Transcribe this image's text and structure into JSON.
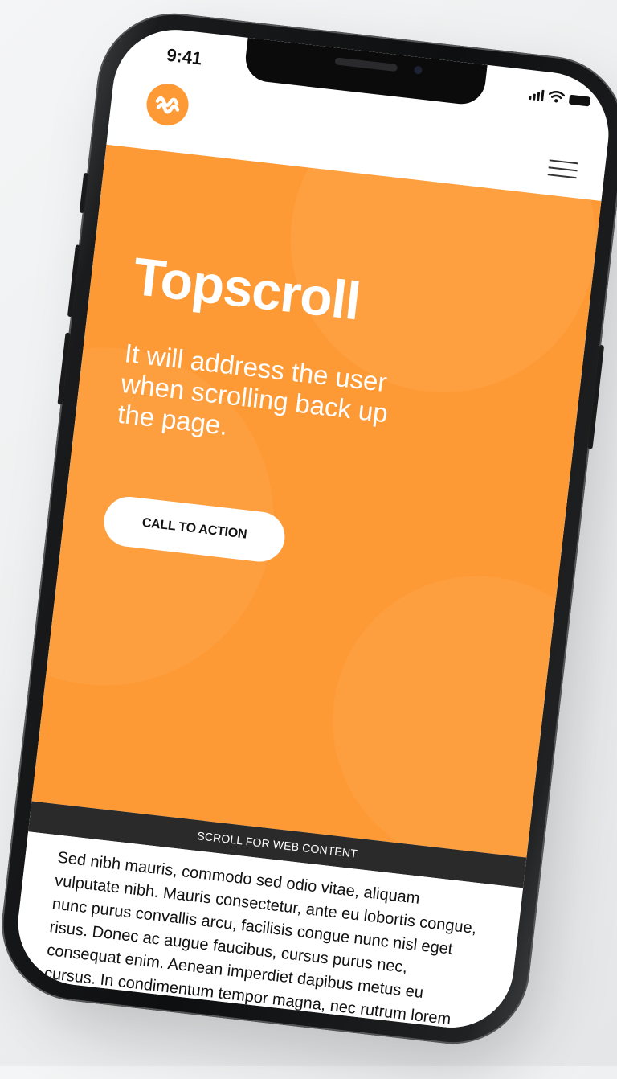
{
  "status_bar": {
    "time": "9:41"
  },
  "header": {
    "logo_icon": "logo-icon",
    "menu_icon": "hamburger-menu-icon"
  },
  "hero": {
    "title": "Topscroll",
    "subtitle": "It will address the user when scrolling back up the page.",
    "cta_label": "CALL TO ACTION",
    "background_color": "#fe9a35"
  },
  "scroll_banner": {
    "label": "SCROLL FOR WEB CONTENT"
  },
  "content": {
    "body_text": "Sed nibh mauris, commodo sed odio vitae, aliquam vulputate nibh. Mauris consectetur, ante eu lobortis congue, nunc purus convallis arcu, facilisis congue nunc nisl eget risus. Donec ac augue faucibus, cursus purus nec, consequat enim. Aenean imperdiet dapibus metus eu cursus. In condimentum tempor magna, nec rutrum lorem euismod ut."
  }
}
